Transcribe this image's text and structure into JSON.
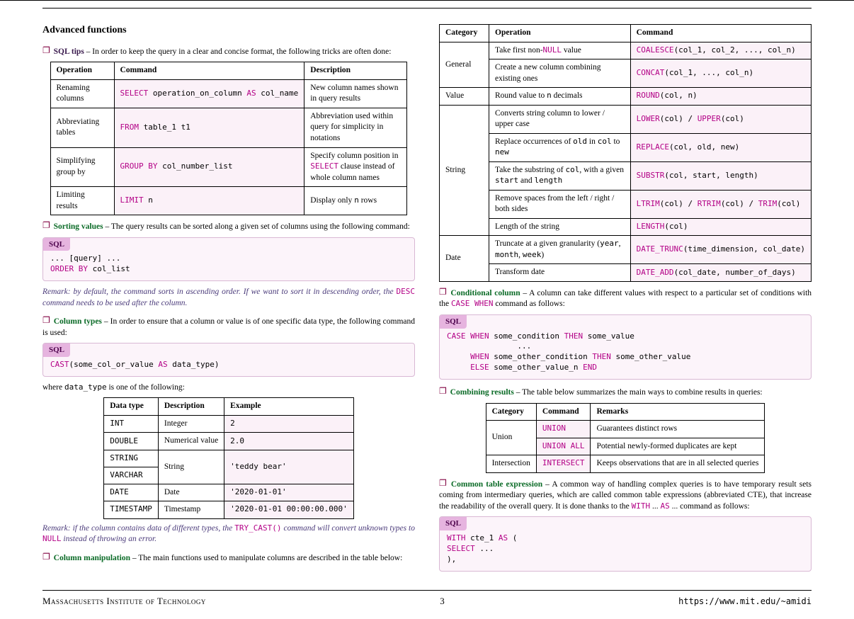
{
  "header_title": "Advanced functions",
  "sql_tips": {
    "name": "SQL tips",
    "desc_pre": " – In order to keep the query in a clear and concise format, the following tricks are often done:",
    "table": {
      "head": [
        "Operation",
        "Command",
        "Description"
      ],
      "rows": [
        {
          "op": "Renaming columns",
          "cmd": "SELECT operation_on_column AS col_name",
          "kw": [
            "SELECT",
            "AS"
          ],
          "desc": "New column names shown in query results"
        },
        {
          "op": "Abbreviating tables",
          "cmd": "FROM table_1 t1",
          "kw": [
            "FROM"
          ],
          "desc": "Abbreviation used within query for simplicity in notations"
        },
        {
          "op": "Simplifying group by",
          "cmd": "GROUP BY col_number_list",
          "kw": [
            "GROUP BY"
          ],
          "desc": "Specify column position in SELECT clause instead of whole column names"
        },
        {
          "op": "Limiting results",
          "cmd": "LIMIT n",
          "kw": [
            "LIMIT"
          ],
          "desc": "Display only n rows"
        }
      ]
    }
  },
  "sorting": {
    "name": "Sorting values",
    "desc": " – The query results can be sorted along a given set of columns using the following command:",
    "sql_label": "SQL",
    "sql_code": "... [query] ...\nORDER BY col_list",
    "remark": "Remark: by default, the command sorts in ascending order. If we want to sort it in descending order, the DESC command needs to be used after the column."
  },
  "coltypes": {
    "name": "Column types",
    "desc": " – In order to ensure that a column or value is of one specific data type, the following command is used:",
    "sql_label": "SQL",
    "sql_code": "CAST(some_col_or_value AS data_type)",
    "where": "where data_type is one of the following:",
    "table": {
      "head": [
        "Data type",
        "Description",
        "Example"
      ],
      "rows": [
        {
          "dt": "INT",
          "desc": "Integer",
          "ex": "2",
          "rs": 1
        },
        {
          "dt": "DOUBLE",
          "desc": "Numerical value",
          "ex": "2.0",
          "rs": 1
        },
        {
          "dt": "STRING",
          "desc": "String",
          "ex": "'teddy bear'",
          "rs": 2
        },
        {
          "dt": "VARCHAR",
          "desc": "",
          "ex": "",
          "rs": 0
        },
        {
          "dt": "DATE",
          "desc": "Date",
          "ex": "'2020-01-01'",
          "rs": 1
        },
        {
          "dt": "TIMESTAMP",
          "desc": "Timestamp",
          "ex": "'2020-01-01 00:00:00.000'",
          "rs": 1
        }
      ]
    },
    "remark": "Remark: if the column contains data of different types, the TRY_CAST() command will convert unknown types to NULL instead of throwing an error."
  },
  "colmanip": {
    "name": "Column manipulation",
    "desc": " – The main functions used to manipulate columns are described in the table below:",
    "table": {
      "head": [
        "Category",
        "Operation",
        "Command"
      ],
      "rows": [
        {
          "cat": "General",
          "catrs": 2,
          "op": "Take first non-NULL value",
          "cmd": "COALESCE(col_1, col_2, ..., col_n)",
          "fn": "COALESCE"
        },
        {
          "cat": "",
          "catrs": 0,
          "op": "Create a new column combining existing ones",
          "cmd": "CONCAT(col_1, ..., col_n)",
          "fn": "CONCAT"
        },
        {
          "cat": "Value",
          "catrs": 1,
          "op": "Round value to n decimals",
          "cmd": "ROUND(col, n)",
          "fn": "ROUND"
        },
        {
          "cat": "String",
          "catrs": 5,
          "op": "Converts string column to lower / upper case",
          "cmd": "LOWER(col) / UPPER(col)",
          "fn": "LOWER"
        },
        {
          "cat": "",
          "catrs": 0,
          "op": "Replace occurrences of old in col to new",
          "cmd": "REPLACE(col, old, new)",
          "fn": "REPLACE"
        },
        {
          "cat": "",
          "catrs": 0,
          "op": "Take the substring of col, with a given start and length",
          "cmd": "SUBSTR(col, start, length)",
          "fn": "SUBSTR"
        },
        {
          "cat": "",
          "catrs": 0,
          "op": "Remove spaces from the left / right / both sides",
          "cmd": "LTRIM(col) / RTRIM(col) / TRIM(col)",
          "fn": "LTRIM"
        },
        {
          "cat": "",
          "catrs": 0,
          "op": "Length of the string",
          "cmd": "LENGTH(col)",
          "fn": "LENGTH"
        },
        {
          "cat": "Date",
          "catrs": 2,
          "op": "Truncate at a given granularity (year, month, week)",
          "cmd": "DATE_TRUNC(time_dimension, col_date)",
          "fn": "DATE_TRUNC"
        },
        {
          "cat": "",
          "catrs": 0,
          "op": "Transform date",
          "cmd": "DATE_ADD(col_date, number_of_days)",
          "fn": "DATE_ADD"
        }
      ]
    }
  },
  "condcol": {
    "name": "Conditional column",
    "desc": " – A column can take different values with respect to a particular set of conditions with the CASE WHEN command as follows:",
    "sql_label": "SQL",
    "sql_code": "CASE WHEN some_condition THEN some_value\n               ...\n     WHEN some_other_condition THEN some_other_value\n     ELSE some_other_value_n END"
  },
  "combining": {
    "name": "Combining results",
    "desc": " – The table below summarizes the main ways to combine results in queries:",
    "table": {
      "head": [
        "Category",
        "Command",
        "Remarks"
      ],
      "rows": [
        {
          "cat": "Union",
          "catrs": 2,
          "cmd": "UNION",
          "rem": "Guarantees distinct rows"
        },
        {
          "cat": "",
          "catrs": 0,
          "cmd": "UNION ALL",
          "rem": "Potential newly-formed duplicates are kept"
        },
        {
          "cat": "Intersection",
          "catrs": 1,
          "cmd": "INTERSECT",
          "rem": "Keeps observations that are in all selected queries"
        }
      ]
    }
  },
  "cte": {
    "name": "Common table expression",
    "desc": " – A common way of handling complex queries is to have temporary result sets coming from intermediary queries, which are called common table expressions (abbreviated CTE), that increase the readability of the overall query. It is done thanks to the WITH ... AS ... command as follows:",
    "sql_label": "SQL",
    "sql_code": "WITH cte_1 AS (\nSELECT ...\n),"
  },
  "footer": {
    "left": "Massachusetts Institute of Technology",
    "page": "3",
    "url": "https://www.mit.edu/~amidi"
  }
}
